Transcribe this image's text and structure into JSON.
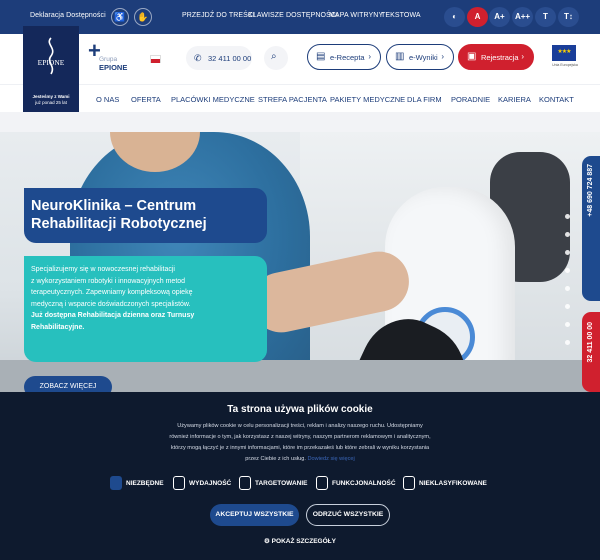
{
  "topbar": {
    "accessibility_statement": "Deklaracja Dostępności",
    "skip_links": [
      "PRZEJDŹ DO TREŚCI",
      "KLAWISZE DOSTĘPNOŚCI",
      "MAPA WITRYNY",
      "TEKSTOWA"
    ],
    "contrast_buttons": [
      "◐",
      "A"
    ],
    "font_buttons": [
      "A+",
      "A++"
    ],
    "text_buttons": [
      "T",
      "T↕"
    ]
  },
  "header": {
    "logo_text": "EPIONE",
    "logo_sub1": "Jesteśmy z Wami",
    "logo_sub2": "już ponad 25 lat",
    "grupa_small": "Grupa",
    "grupa_name": "EPIONE",
    "phone": "32 411 00 00",
    "erecepta": "e-Recepta",
    "ewyniki": "e-Wyniki",
    "rejestracja": "Rejestracja",
    "eu_label": "Unia Europejska"
  },
  "nav": [
    "O NAS",
    "OFERTA",
    "PLACÓWKI MEDYCZNE",
    "STREFA PACJENTA",
    "PAKIETY MEDYCZNE",
    "DLA FIRM",
    "PORADNIE",
    "KARIERA",
    "KONTAKT"
  ],
  "hero": {
    "title_line1": "NeuroKlinika – Centrum",
    "title_line2": "Rehabilitacji Robotycznej",
    "desc_lines": [
      "Specjalizujemy się w nowoczesnej rehabilitacji",
      "z wykorzystaniem robotyki i innowacyjnych metod",
      "terapeutycznych. Zapewniamy kompleksową opiekę",
      "medyczną i wsparcie doświadczonych specjalistów."
    ],
    "desc_bold1": "Już dostępna Rehabilitacja dzienna oraz Turnusy",
    "desc_bold2": "Rehabilitacyjne.",
    "button": "ZOBACZ WIĘCEJ",
    "side_phone_en": "+48 690 724 887",
    "side_phone_pl": "32 411 00 00"
  },
  "cookie": {
    "title": "Ta strona używa plików cookie",
    "body_lines": [
      "Używamy plików cookie w celu personalizacji treści, reklam i analizy naszego ruchu. Udostępniamy",
      "również informacje o tym, jak korzystasz z naszej witryny, naszym partnerom reklamowym i analitycznym,",
      "którzy mogą łączyć je z innymi informacjami, które im przekazałeś lub które zebrali w wyniku korzystania",
      "przez Ciebie z ich usług."
    ],
    "link": "Dowiedz się więcej",
    "options": [
      "NIEZBĘDNE",
      "WYDAJNOŚĆ",
      "TARGETOWANIE",
      "FUNKCJONALNOŚĆ",
      "NIEKLASYFIKOWANE"
    ],
    "accept": "AKCEPTUJ WSZYSTKIE",
    "reject": "ODRZUĆ WSZYSTKIE",
    "details": "POKAŻ SZCZEGÓŁY"
  },
  "colors": {
    "navy": "#1d3d7a",
    "teal": "#27c0be",
    "red": "#d0202e",
    "cookie_bg": "#0e1a2e"
  }
}
